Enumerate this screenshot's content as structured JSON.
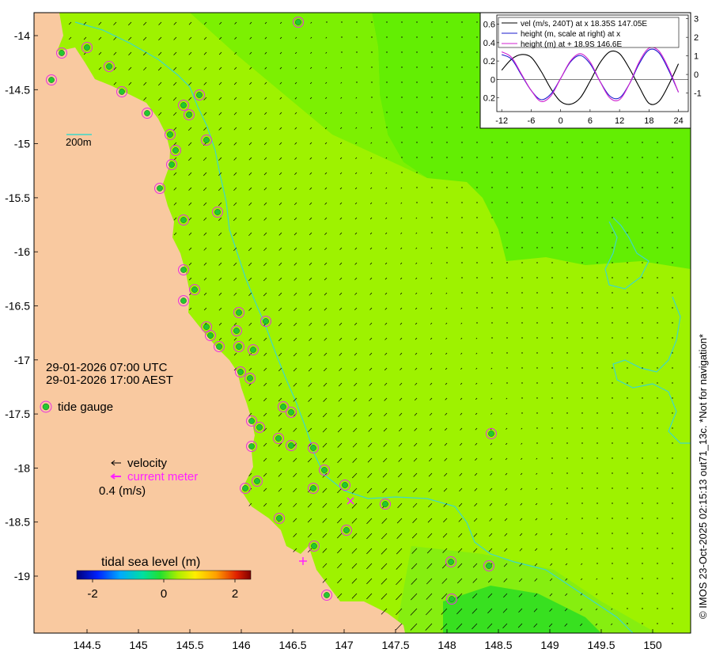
{
  "map": {
    "lon_ticks": [
      "144.5",
      "145",
      "145.5",
      "146",
      "146.5",
      "147",
      "147.5",
      "148",
      "148.5",
      "149",
      "149.5",
      "150"
    ],
    "lat_ticks": [
      "-14",
      "-14.5",
      "-15",
      "-15.5",
      "-16",
      "-16.5",
      "-17",
      "-17.5",
      "-18",
      "-18.5",
      "-19"
    ],
    "scale_bar_label": "200m",
    "time_utc": "29-01-2026 07:00 UTC",
    "time_local": "29-01-2026 17:00 AEST",
    "colors": {
      "land": "#f9c9a0",
      "sea": "#9ef200",
      "sea_deep": "#63ee03",
      "contour": "#3ed8c8",
      "gauge": "#e830e0",
      "current_meter": "#ff22ff"
    }
  },
  "legend": {
    "tide_gauge": "tide gauge",
    "velocity": "velocity",
    "current_meter": "current meter",
    "speed_scale": "0.4 (m/s)",
    "colorbar_title": "tidal sea level (m)",
    "colorbar_ticks": [
      "-2",
      "0",
      "2"
    ]
  },
  "inset": {
    "legend": [
      "vel (m/s, 240T) at x 18.35S 147.05E",
      "height (m, scale at right) at x",
      "height (m) at + 18.9S 146.6E"
    ],
    "left_ticks": [
      "0.6",
      "0.4",
      "0.2",
      "0",
      "0.2"
    ],
    "right_ticks": [
      "3",
      "2",
      "1",
      "0",
      "-1"
    ],
    "x_ticks": [
      "-12",
      "-6",
      "0",
      "6",
      "12",
      "18",
      "24"
    ]
  },
  "credit": "© IMOS 23-Oct-2025 02:15:13 out71_13c. *Not for navigation*",
  "chart_data": {
    "type": "line",
    "x": [
      -12,
      -10,
      -8,
      -6,
      -4,
      -2,
      0,
      2,
      4,
      6,
      8,
      10,
      12,
      14,
      16,
      18,
      20,
      22,
      24
    ],
    "xlim": [
      -13,
      26
    ],
    "ylim": [
      -0.35,
      0.7
    ],
    "y2lim": [
      -2,
      3.2
    ],
    "series": [
      {
        "name": "vel (m/s, 240T) at x 18.35S 147.05E",
        "color": "#000000",
        "axis": "left",
        "values": [
          0.1,
          0.22,
          0.27,
          0.24,
          0.09,
          -0.1,
          -0.24,
          -0.27,
          -0.2,
          -0.02,
          0.18,
          0.3,
          0.28,
          0.12,
          -0.08,
          -0.26,
          -0.24,
          -0.06,
          0.17
        ]
      },
      {
        "name": "height (m, scale at right) at x",
        "color": "#1a1acc",
        "axis": "left",
        "values": [
          0.27,
          0.22,
          0.05,
          -0.12,
          -0.22,
          -0.16,
          0.01,
          0.19,
          0.26,
          0.17,
          -0.02,
          -0.18,
          -0.2,
          -0.05,
          0.17,
          0.32,
          0.29,
          0.1,
          -0.14
        ]
      },
      {
        "name": "height (m) at + 18.9S 146.6E",
        "color": "#d020d0",
        "axis": "left",
        "values": [
          0.3,
          0.24,
          0.06,
          -0.12,
          -0.24,
          -0.18,
          0.01,
          0.2,
          0.28,
          0.19,
          -0.02,
          -0.2,
          -0.22,
          -0.05,
          0.19,
          0.34,
          0.31,
          0.12,
          -0.14
        ]
      }
    ]
  }
}
